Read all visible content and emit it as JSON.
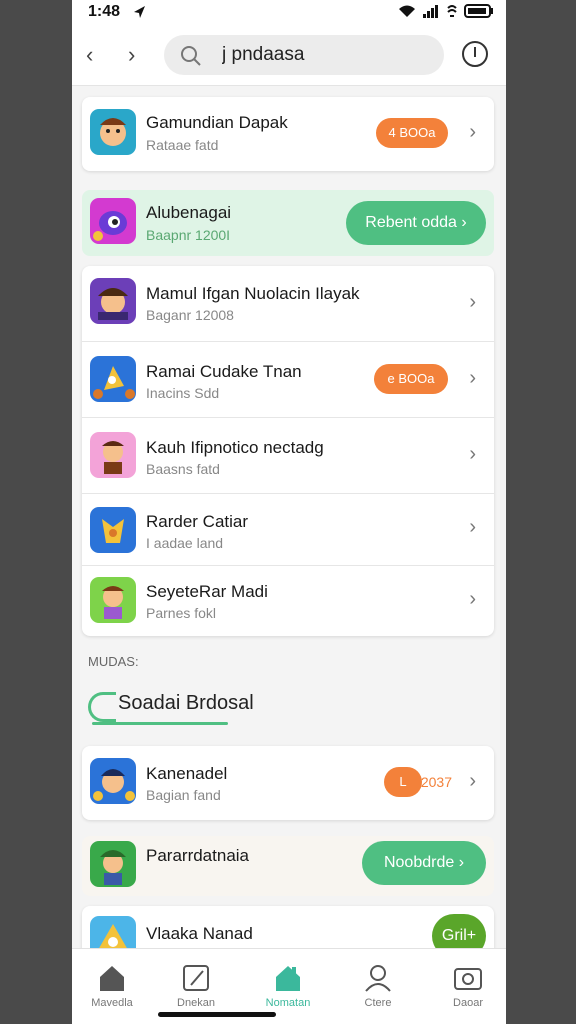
{
  "status_bar": {
    "time": "1:48"
  },
  "search": {
    "query": "j pndaasa"
  },
  "list1": [
    {
      "title": "Gamundian Dapak",
      "subtitle": "Rataae fatd",
      "badge": "4 BOOa",
      "icon_color": "#2aa7c9"
    },
    {
      "title": "Alubenagai",
      "subtitle": "Baapnr 1200I",
      "button": "Rebent odda",
      "icon_color": "#d33ad0",
      "highlight": "#dff4e6"
    },
    {
      "title": "Mamul Ifgan Nuolacin Ilayak",
      "subtitle": "Baganr 12008",
      "icon_color": "#6c3fb8"
    },
    {
      "title": "Ramai Cudake Tnan",
      "subtitle": "Inacins Sdd",
      "badge": "e BOOa",
      "icon_color": "#2b73d8"
    },
    {
      "title": "Kauh Ifipnotico nectadg",
      "subtitle": "Baasns fatd",
      "icon_color": "#f3a3d8"
    },
    {
      "title": "Rarder Catiar",
      "subtitle": "I aadae land",
      "icon_color": "#2b73d8"
    },
    {
      "title": "SeyeteRar Madi",
      "subtitle": "Parnes fokl",
      "icon_color": "#7ed34a"
    }
  ],
  "section_label": "MUDAS:",
  "section_heading": "Soadai Brdosal",
  "list2": [
    {
      "title": "Kanenadel",
      "subtitle": "Bagian fand",
      "badge": "L",
      "badge_count": "2037",
      "icon_color": "#2b73d8"
    },
    {
      "title": "Pararrdatnaia",
      "button": "Noobdrde",
      "icon_color": "#39a94a"
    },
    {
      "title": "Vlaaka Nanad",
      "button": "Gril+",
      "icon_color": "#4cb5e8"
    }
  ],
  "tabs": [
    {
      "label": "Mavedla",
      "icon": "home-icon"
    },
    {
      "label": "Dnekan",
      "icon": "square-icon"
    },
    {
      "label": "Nomatan",
      "icon": "house-active-icon"
    },
    {
      "label": "Ctere",
      "icon": "person-icon"
    },
    {
      "label": "Daoar",
      "icon": "camera-icon"
    }
  ],
  "colors": {
    "accent_green": "#4fbf82",
    "accent_orange": "#f3813a",
    "active_tab": "#3bb89c"
  }
}
